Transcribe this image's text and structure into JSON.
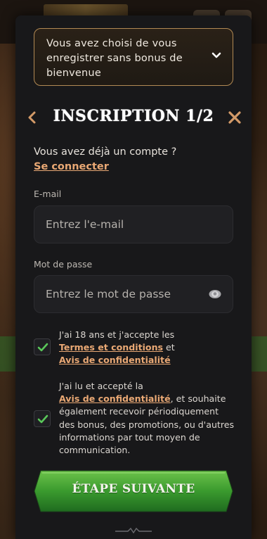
{
  "bonus_selector": {
    "text": "Vous avez choisi de vous enregistrer sans bonus de bienvenue",
    "icon": "chevron-down-icon"
  },
  "header": {
    "title": "INSCRIPTION 1/2",
    "back_icon": "chevron-left-icon",
    "close_icon": "close-icon"
  },
  "login": {
    "question": "Vous avez déjà un compte ?",
    "link": "Se connecter"
  },
  "email": {
    "label": "E-mail",
    "placeholder": "Entrez l'e-mail",
    "value": ""
  },
  "password": {
    "label": "Mot de passe",
    "placeholder": "Entrez le mot de passe",
    "value": "",
    "icon": "eye-icon"
  },
  "consents": [
    {
      "checked": true,
      "text_before": "J'ai 18 ans et j'accepte les",
      "link1": "Termes et conditions",
      "middle": "et",
      "link2": "Avis de confidentialité"
    },
    {
      "checked": true,
      "text_before": "J'ai lu et accepté la",
      "link": "Avis de confidentialité",
      "text_after": ", et souhaite également recevoir périodiquement des bonus, des promotions, ou d'autres informations par tout moyen de communication."
    }
  ],
  "next_button": "ÉTAPE SUIVANTE",
  "colors": {
    "accent": "#e9a874",
    "modal_bg": "#18181a",
    "button_green": "#3a9a3a",
    "check_green": "#5ac85a",
    "border_gold": "#b28a54"
  }
}
